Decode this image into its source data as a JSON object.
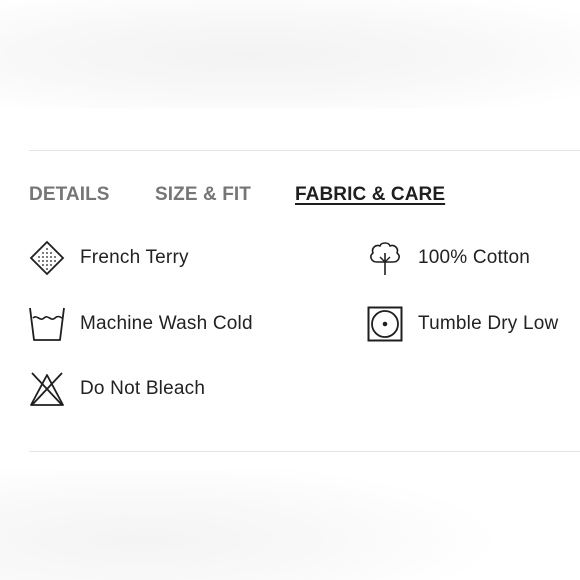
{
  "tabs": [
    {
      "label": "DETAILS",
      "active": false
    },
    {
      "label": "SIZE & FIT",
      "active": false
    },
    {
      "label": "FABRIC & CARE",
      "active": true
    }
  ],
  "care_items": [
    {
      "label": "French Terry",
      "icon": "fabric-knit-icon"
    },
    {
      "label": "100% Cotton",
      "icon": "cotton-plant-icon"
    },
    {
      "label": "Machine Wash Cold",
      "icon": "wash-cold-icon"
    },
    {
      "label": "Tumble Dry Low",
      "icon": "tumble-dry-low-icon"
    },
    {
      "label": "Do Not Bleach",
      "icon": "do-not-bleach-icon"
    }
  ],
  "colors": {
    "text": "#1f1f1f",
    "inactive_tab": "#767676",
    "divider": "#e4e4e4"
  }
}
